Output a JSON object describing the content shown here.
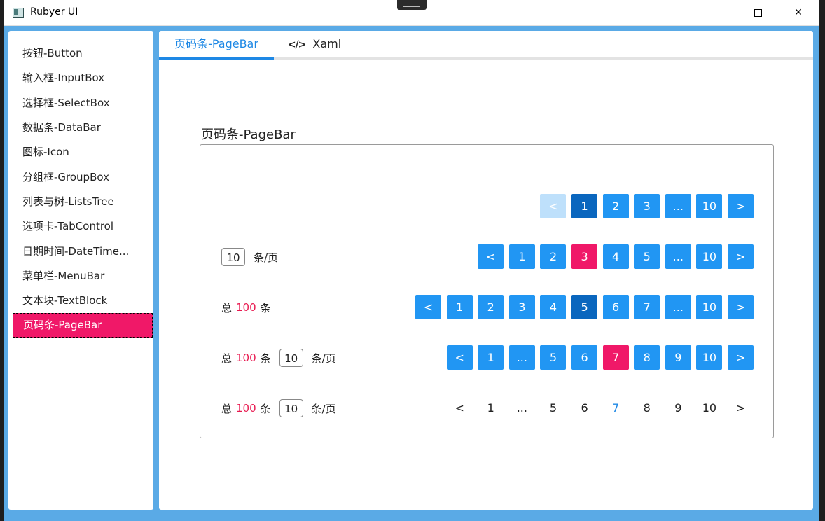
{
  "window": {
    "title": "Rubyer UI"
  },
  "sidebar": {
    "items": [
      {
        "label": "按钮-Button"
      },
      {
        "label": "输入框-InputBox"
      },
      {
        "label": "选择框-SelectBox"
      },
      {
        "label": "数据条-DataBar"
      },
      {
        "label": "图标-Icon"
      },
      {
        "label": "分组框-GroupBox"
      },
      {
        "label": "列表与树-ListsTree"
      },
      {
        "label": "选项卡-TabControl"
      },
      {
        "label": "日期时间-DateTime..."
      },
      {
        "label": "菜单栏-MenuBar"
      },
      {
        "label": "文本块-TextBlock"
      },
      {
        "label": "页码条-PageBar",
        "active": true
      }
    ]
  },
  "tabs": [
    {
      "label": "页码条-PageBar",
      "active": true
    },
    {
      "label": "Xaml",
      "icon": "code-icon"
    }
  ],
  "section": {
    "title": "页码条-PageBar"
  },
  "labels": {
    "total_prefix": "总",
    "total_suffix": "条",
    "per_page": "条/页",
    "total_value": "100",
    "page_size": "10"
  },
  "pagebars": [
    {
      "style": "filled",
      "buttons": [
        {
          "label": "<",
          "state": "disabled"
        },
        {
          "label": "1",
          "state": "selected-dark"
        },
        {
          "label": "2"
        },
        {
          "label": "3"
        },
        {
          "label": "..."
        },
        {
          "label": "10"
        },
        {
          "label": ">"
        }
      ]
    },
    {
      "style": "filled",
      "buttons": [
        {
          "label": "<"
        },
        {
          "label": "1"
        },
        {
          "label": "2"
        },
        {
          "label": "3",
          "state": "selected-red"
        },
        {
          "label": "4"
        },
        {
          "label": "5"
        },
        {
          "label": "..."
        },
        {
          "label": "10"
        },
        {
          "label": ">"
        }
      ]
    },
    {
      "style": "filled",
      "buttons": [
        {
          "label": "<"
        },
        {
          "label": "1"
        },
        {
          "label": "2"
        },
        {
          "label": "3"
        },
        {
          "label": "4"
        },
        {
          "label": "5",
          "state": "selected-dark"
        },
        {
          "label": "6"
        },
        {
          "label": "7"
        },
        {
          "label": "..."
        },
        {
          "label": "10"
        },
        {
          "label": ">"
        }
      ]
    },
    {
      "style": "filled",
      "buttons": [
        {
          "label": "<"
        },
        {
          "label": "1"
        },
        {
          "label": "..."
        },
        {
          "label": "5"
        },
        {
          "label": "6"
        },
        {
          "label": "7",
          "state": "selected-red"
        },
        {
          "label": "8"
        },
        {
          "label": "9"
        },
        {
          "label": "10"
        },
        {
          "label": ">"
        }
      ]
    },
    {
      "style": "plain",
      "buttons": [
        {
          "label": "<"
        },
        {
          "label": "1"
        },
        {
          "label": "..."
        },
        {
          "label": "5"
        },
        {
          "label": "6"
        },
        {
          "label": "7",
          "state": "selected-blue"
        },
        {
          "label": "8"
        },
        {
          "label": "9"
        },
        {
          "label": "10"
        },
        {
          "label": ">"
        }
      ]
    }
  ],
  "colors": {
    "accent": "#2196f3",
    "accent_dark": "#0a66be",
    "accent_disabled": "#bee0fb",
    "highlight": "#f01868",
    "frame": "#5aaae6"
  }
}
